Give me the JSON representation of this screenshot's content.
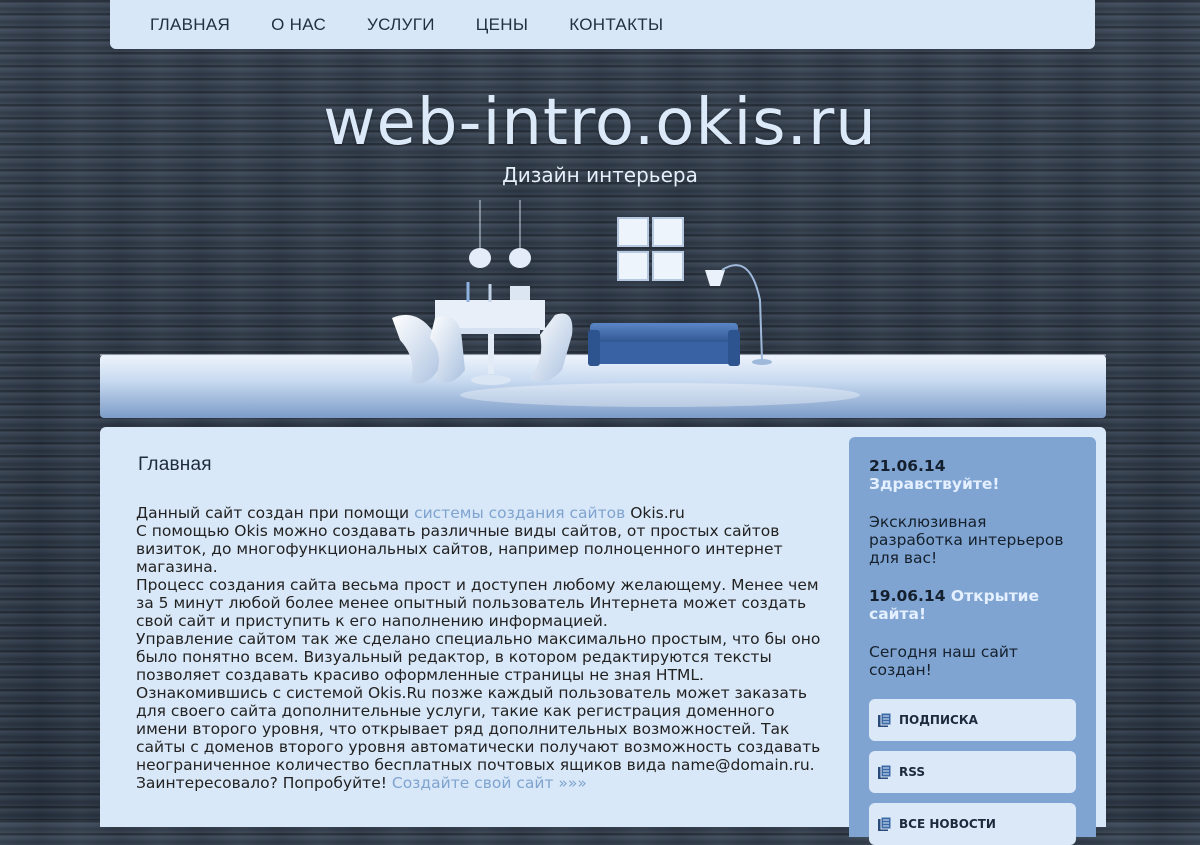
{
  "nav": {
    "items": [
      "ГЛАВНАЯ",
      "О НАС",
      "УСЛУГИ",
      "ЦЕНЫ",
      "КОНТАКТЫ"
    ]
  },
  "header": {
    "title": "web-intro.okis.ru",
    "subtitle": "Дизайн интерьера"
  },
  "main": {
    "title": "Главная",
    "p1_before": "Данный сайт создан при помощи ",
    "p1_link": "системы создания сайтов",
    "p1_after": " Okis.ru",
    "p2": "С помощью Okis можно создавать различные виды сайтов, от простых сайтов визиток, до многофункциональных сайтов, например полноценного интернет магазина.",
    "p3": "Процесс создания сайта весьма прост и доступен любому желающему. Менее чем за 5 минут любой более менее опытный пользователь Интернета может создать свой сайт и приступить к его наполнению информацией.",
    "p4": "Управление сайтом так же сделано специально максимально простым, что бы оно было понятно всем. Визуальный редактор, в котором редактируются тексты позволяет создавать красиво оформленные страницы не зная HTML.",
    "p5": "Ознакомившись с системой Okis.Ru позже каждый пользователь может заказать для своего сайта дополнительные услуги, такие как регистрация доменного имени второго уровня, что открывает ряд дополнительных возможностей. Так сайты с доменов второго уровня автоматически получают возможность создавать неограниченное количество бесплатных почтовых ящиков вида name@domain.ru.",
    "p6_before": "Заинтересовало? Попробуйте! ",
    "p6_link": "Создайте свой сайт »»»"
  },
  "sidebar": {
    "news": [
      {
        "date": "21.06.14",
        "title": "Здравствуйте!",
        "text": "Эксклюзивная разработка интерьеров для вас!"
      },
      {
        "date": "19.06.14",
        "title": "Открытие сайта!",
        "text": "Сегодня наш сайт создан!"
      }
    ],
    "buttons": [
      {
        "label": "ПОДПИСКА",
        "icon": "document-icon"
      },
      {
        "label": "RSS",
        "icon": "document-icon"
      },
      {
        "label": "ВСЕ НОВОСТИ",
        "icon": "document-icon"
      }
    ]
  },
  "colors": {
    "nav_bg": "#d8e7f7",
    "content_bg": "#d9e8f8",
    "sidebar_bg": "#7fa4d2",
    "link": "#7ea3cf"
  }
}
